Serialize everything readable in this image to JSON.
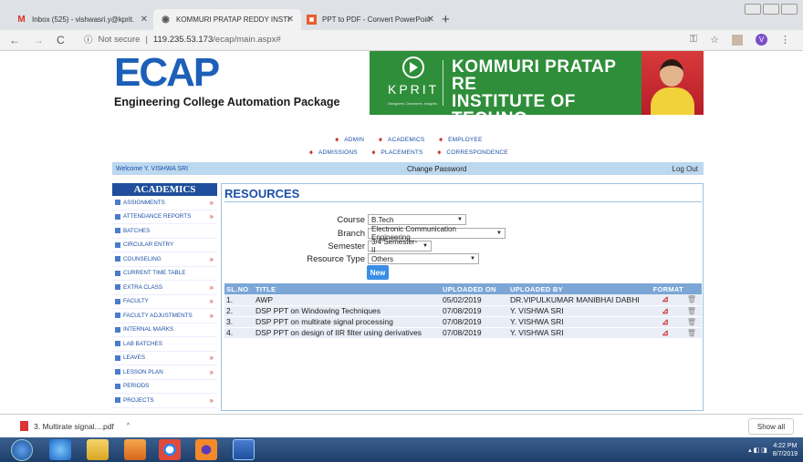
{
  "browser": {
    "tabs": [
      {
        "title": "Inbox (525) - vishwasri.y@kprit.",
        "icon": "gmail-icon"
      },
      {
        "title": "KOMMURI PRATAP REDDY INSTI",
        "icon": "site-icon"
      },
      {
        "title": "PPT to PDF - Convert PowerPoin",
        "icon": "ppt2pdf-icon"
      }
    ],
    "new_tab": "+",
    "url_security": "Not secure",
    "url_host": "119.235.53.173",
    "url_path": "/ecap/main.aspx#",
    "profile_initial": "V"
  },
  "banner": {
    "logo": "ECAP",
    "subtitle": "Engineering College Automation Package",
    "kprit": "KPRIT",
    "kprit_tag": "Designers. Dreamers. Insights.",
    "college_line1": "KOMMURI PRATAP RE",
    "college_line2": "INSTITUTE OF TECHNO"
  },
  "topmenu": {
    "row1": [
      "ADMIN",
      "ACADEMICS",
      "EMPLOYEE"
    ],
    "row2": [
      "ADMISSIONS",
      "PLACEMENTS",
      "CORRESPONDENCE"
    ]
  },
  "welcome": {
    "user": "Welcome Y. VISHWA SRI",
    "change_password": "Change Password",
    "logout": "Log Out"
  },
  "sidebar": {
    "heading": "ACADEMICS",
    "items": [
      {
        "label": "ASSIGNMENTS",
        "sub": true
      },
      {
        "label": "ATTENDANCE REPORTS",
        "sub": true
      },
      {
        "label": "BATCHES",
        "sub": false
      },
      {
        "label": "CIRCULAR ENTRY",
        "sub": false
      },
      {
        "label": "COUNSELING",
        "sub": true
      },
      {
        "label": "CURRENT TIME TABLE",
        "sub": false
      },
      {
        "label": "EXTRA CLASS",
        "sub": true
      },
      {
        "label": "FACULTY",
        "sub": true
      },
      {
        "label": "FACULTY ADJUSTMENTS",
        "sub": true
      },
      {
        "label": "INTERNAL MARKS",
        "sub": false
      },
      {
        "label": "LAB BATCHES",
        "sub": false
      },
      {
        "label": "LEAVES",
        "sub": true
      },
      {
        "label": "LESSON PLAN",
        "sub": true
      },
      {
        "label": "PERIODS",
        "sub": false
      },
      {
        "label": "PROJECTS",
        "sub": true
      }
    ]
  },
  "resources": {
    "title": "RESOURCES",
    "form": {
      "course_label": "Course",
      "course_value": "B.Tech",
      "branch_label": "Branch",
      "branch_value": "Electronic Communication Engineering",
      "semester_label": "Semester",
      "semester_value": "3/4 Semester-II",
      "type_label": "Resource Type",
      "type_value": "Others",
      "new_button": "New"
    },
    "columns": [
      "SL.NO",
      "TITLE",
      "UPLOADED ON",
      "UPLOADED BY",
      "FORMAT"
    ],
    "rows": [
      {
        "sl": "1.",
        "title": "AWP",
        "date": "05/02/2019",
        "by": "DR.VIPULKUMAR MANIBHAI DABHI"
      },
      {
        "sl": "2.",
        "title": "DSP PPT on Windowing Techniques",
        "date": "07/08/2019",
        "by": "Y. VISHWA SRI"
      },
      {
        "sl": "3.",
        "title": "DSP PPT on multirate signal processing",
        "date": "07/08/2019",
        "by": "Y. VISHWA SRI"
      },
      {
        "sl": "4.",
        "title": "DSP PPT on design of IIR filter using derivatives",
        "date": "07/08/2019",
        "by": "Y. VISHWA SRI"
      }
    ]
  },
  "downloads": {
    "file": "3. Multirate signal....pdf",
    "show_all": "Show all"
  },
  "taskbar": {
    "time": "4:22 PM",
    "date": "8/7/2019"
  }
}
